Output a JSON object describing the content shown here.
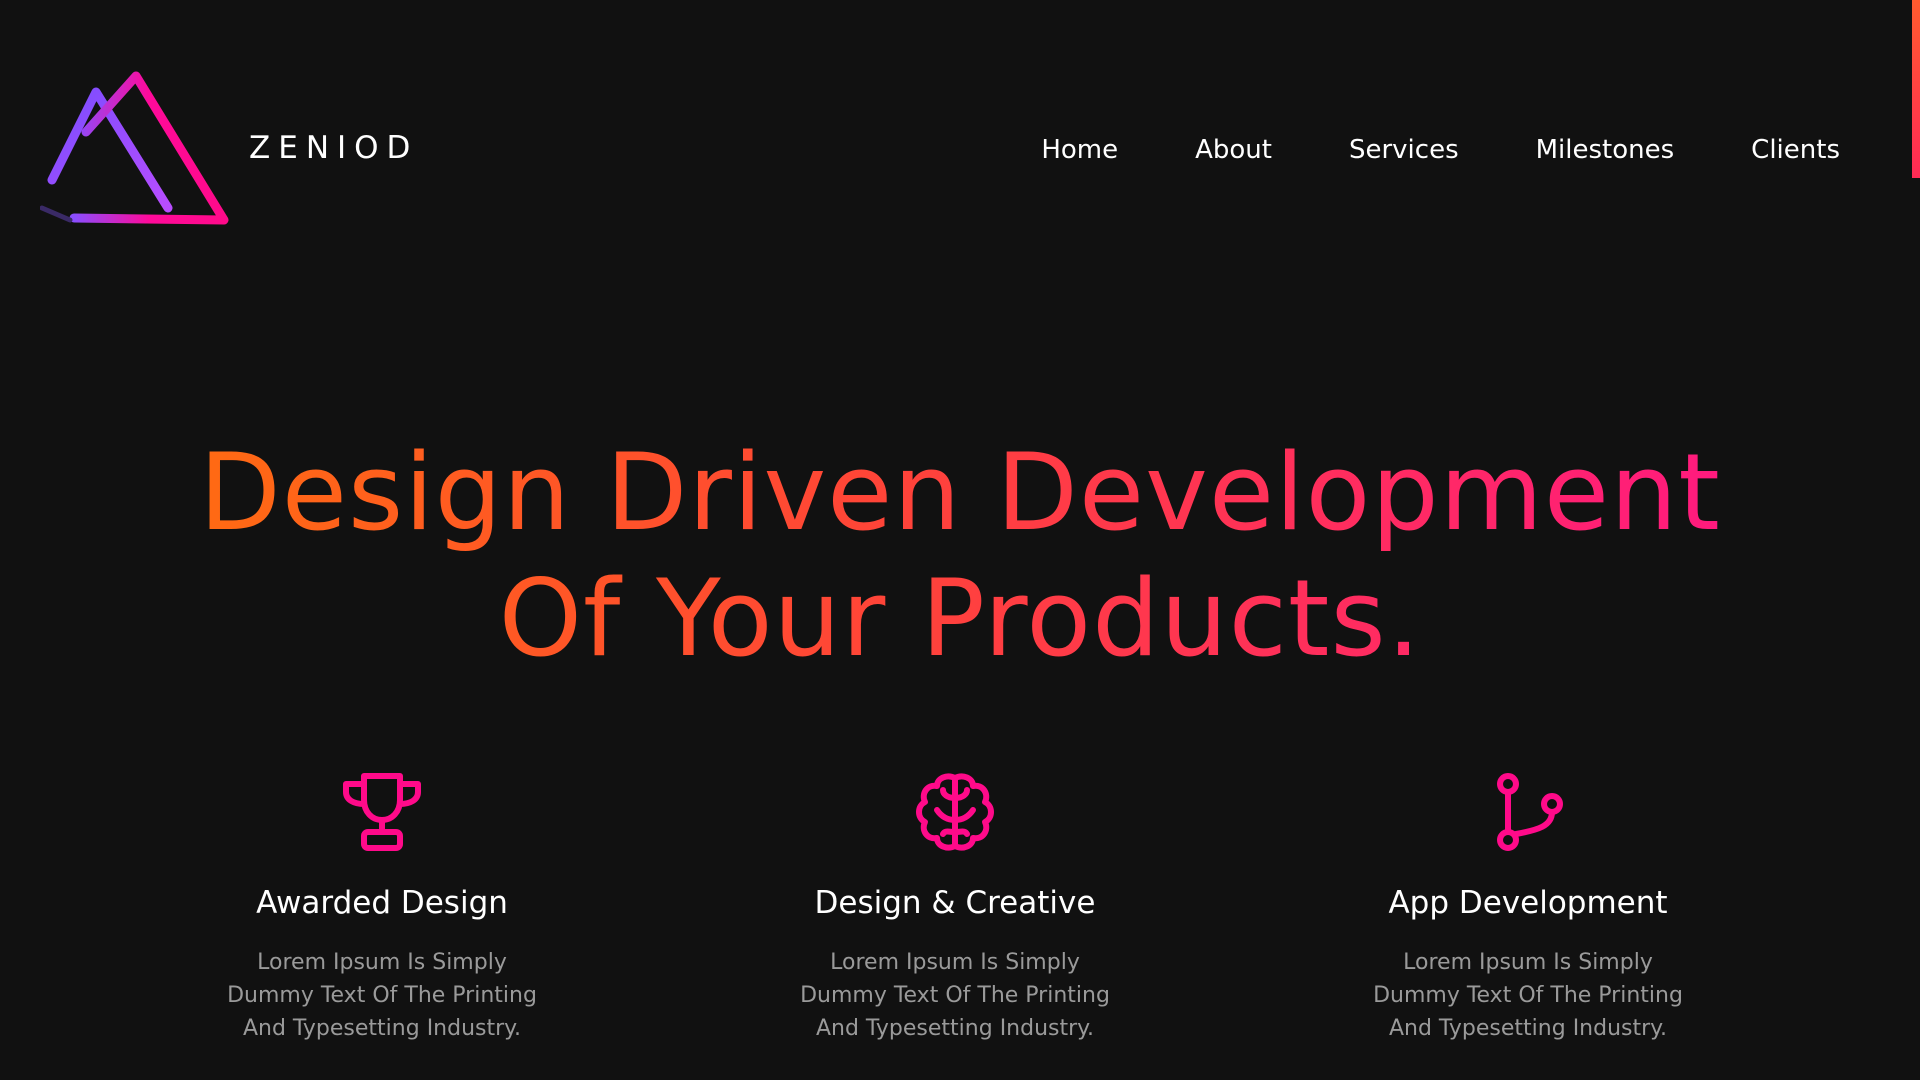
{
  "colors": {
    "background": "#111111",
    "accent_pink": "#ff0a8a",
    "gradient_start": "#ff6a13",
    "gradient_end": "#ff1a7e",
    "logo_purple": "#8a4dff",
    "text": "#ffffff",
    "muted_text": "#9a9a9a"
  },
  "header": {
    "logo_icon": "mountain-triangles-logo",
    "brand": "ZENIOD",
    "nav": [
      "Home",
      "About",
      "Services",
      "Milestones",
      "Clients"
    ]
  },
  "hero": {
    "line1": "Design Driven Development",
    "line2": "Of Your Products."
  },
  "features": [
    {
      "icon": "trophy-icon",
      "title": "Awarded Design",
      "desc": "Lorem Ipsum Is Simply Dummy Text Of The Printing And Typesetting Industry."
    },
    {
      "icon": "brain-icon",
      "title": "Design & Creative",
      "desc": "Lorem Ipsum Is Simply Dummy Text Of The Printing And Typesetting Industry."
    },
    {
      "icon": "git-branch-icon",
      "title": "App Development",
      "desc": "Lorem Ipsum Is Simply Dummy Text Of The Printing And Typesetting Industry."
    }
  ]
}
